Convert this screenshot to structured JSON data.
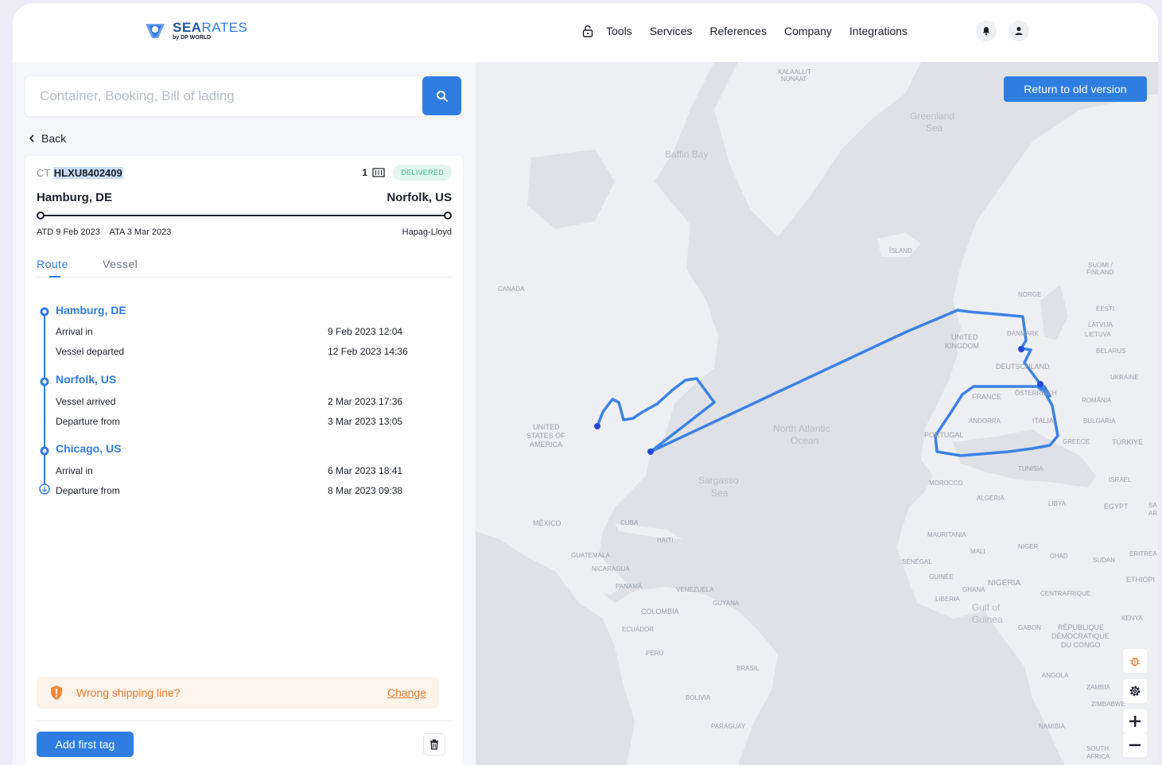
{
  "brand": {
    "name_bold": "SEA",
    "name_light": "RATES",
    "sub": "by DP WORLD"
  },
  "nav": {
    "items": [
      "Tools",
      "Services",
      "References",
      "Company",
      "Integrations"
    ]
  },
  "search": {
    "placeholder": "Container, Booking, Bill of lading"
  },
  "back_label": "Back",
  "shipment": {
    "prefix": "CT",
    "number": "HLXU8402409",
    "quantity": "1",
    "status": "DELIVERED",
    "origin": "Hamburg, DE",
    "destination": "Norfolk, US",
    "atd": "ATD 9 Feb 2023",
    "ata": "ATA 3 Mar 2023",
    "carrier": "Hapag-Lloyd"
  },
  "tabs": {
    "route": "Route",
    "vessel": "Vessel"
  },
  "timeline": [
    {
      "port": "Hamburg, DE",
      "events": [
        {
          "label": "Arrival in",
          "date": "9 Feb 2023 12:04"
        },
        {
          "label": "Vessel departed",
          "date": "12 Feb 2023 14:36"
        }
      ]
    },
    {
      "port": "Norfolk, US",
      "events": [
        {
          "label": "Vessel arrived",
          "date": "2 Mar 2023 17:36"
        },
        {
          "label": "Departure from",
          "date": "3 Mar 2023 13:05"
        }
      ]
    },
    {
      "port": "Chicago, US",
      "events": [
        {
          "label": "Arrival in",
          "date": "6 Mar 2023 18:41"
        },
        {
          "label": "Departure from",
          "date": "8 Mar 2023 09:38"
        }
      ]
    }
  ],
  "warning": {
    "text": "Wrong shipping line?",
    "link": "Change"
  },
  "tag_button": "Add first tag",
  "map": {
    "return_button": "Return to old version",
    "labels": {
      "kalaallit": "KALAALLIT",
      "nunaat": "NUNAAT",
      "greenland_sea_1": "Greenland",
      "greenland_sea_2": "Sea",
      "baffin_bay": "Baffin Bay",
      "island": "ÍSLAND",
      "suomi_1": "SUOMI /",
      "suomi_2": "FINLAND",
      "canada": "CANADA",
      "norge": "NORGE",
      "eesti": "EESTI",
      "latvija": "LATVIJA",
      "lietuva": "LIETUVA",
      "danmark": "DANMARK",
      "uk_1": "UNITED",
      "uk_2": "KINGDOM",
      "belarus": "BELARUS",
      "deutschland": "DEUTSCHLAND",
      "ukraine": "UKRAINE",
      "france": "FRANCE",
      "osterreich": "ÖSTERREICH",
      "romania": "ROMÂNIA",
      "andorra": "ANDORRA",
      "italia": "ITALIA",
      "bulgaria": "BULGARIA",
      "portugal": "PORTUGAL",
      "greece": "GREECE",
      "turkiye": "TÜRKIYE",
      "usa_1": "UNITED",
      "usa_2": "STATES OF",
      "usa_3": "AMERICA",
      "north_atlantic_1": "North Atlantic",
      "north_atlantic_2": "Ocean",
      "tunisia": "TUNISIA",
      "sargasso_1": "Sargasso",
      "sargasso_2": "Sea",
      "morocco": "MOROCCO",
      "israel": "ISRAEL",
      "algeria": "ALGERIA",
      "libya": "LIBYA",
      "egypt": "EGYPT",
      "sa_1": "SA",
      "sa_2": "AR",
      "mexico": "MÉXICO",
      "cuba": "CUBA",
      "haiti": "HAITI",
      "mauritania": "MAURITANIA",
      "mali": "MALI",
      "niger": "NIGER",
      "chad": "CHAD",
      "sudan": "SUDAN",
      "eritrea": "ERITREA",
      "guatemala": "GUATEMALA",
      "senegal": "SÉNÉGAL",
      "nicaragua": "NICARAGUA",
      "guinee": "GUINÉE",
      "nigeria": "NIGERIA",
      "ethiopia": "ETHIOPI",
      "panama": "PANAMÁ",
      "venezuela": "VENEZUELA",
      "ghana": "GHANA",
      "centrafrique": "CENTRAFRIQUE",
      "liberia": "LIBERIA",
      "guyana": "GUYANA",
      "gulf_1": "Gulf of",
      "gulf_2": "Guinea",
      "colombia": "COLOMBIA",
      "kenya": "KENYA",
      "gabon": "GABON",
      "rdc_1": "RÉPUBLIQUE",
      "rdc_2": "DÉMOCRATIQUE",
      "rdc_3": "DU CONGO",
      "ecuador": "ECUADOR",
      "peru": "PERÚ",
      "brasil": "BRASIL",
      "angola": "ANGOLA",
      "zambia": "ZAMBIA",
      "bolivia": "BOLIVIA",
      "zimbabwe": "ZIMBABWE",
      "paraguay": "PARAGUAY",
      "namibia": "NAMIBIA",
      "south_africa_1": "SOUTH",
      "south_africa_2": "AFRICA"
    }
  },
  "colors": {
    "accent": "#2f7de1",
    "delivered": "#38b489",
    "warning": "#e67a2e",
    "map_water": "#dfe1e6",
    "map_land": "#eeeff2"
  },
  "icons": [
    "lock-icon",
    "bell-icon",
    "user-icon",
    "search-icon",
    "chevron-left-icon",
    "container-icon",
    "shield-warning-icon",
    "trash-icon",
    "bug-icon",
    "gear-icon",
    "plus-icon",
    "minus-icon"
  ]
}
